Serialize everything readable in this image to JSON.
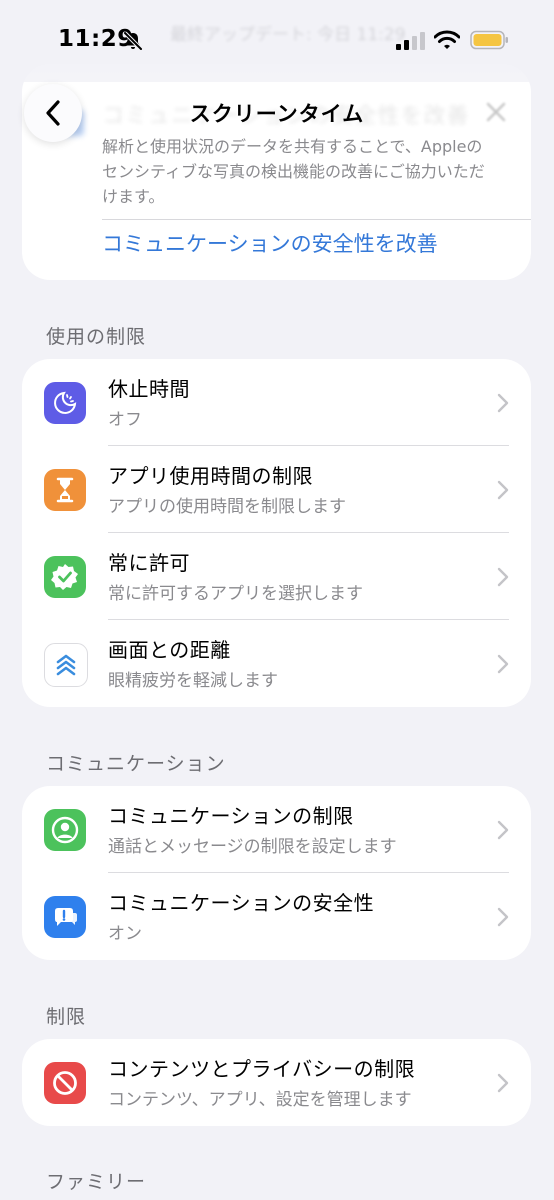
{
  "status_bar": {
    "time": "11:29",
    "ghost_text": "最終アップデート: 今日 11:29"
  },
  "nav": {
    "title": "スクリーンタイム"
  },
  "banner": {
    "heading": "コミュニケーションの安全性を改善",
    "description": "解析と使用状況のデータを共有することで、Appleのセンシティブな写真の検出機能の改善にご協力いただけます。",
    "link": "コミュニケーションの安全性を改善"
  },
  "sections": {
    "usage": {
      "header": "使用の制限",
      "rows": [
        {
          "title": "休止時間",
          "subtitle": "オフ",
          "icon": "downtime-icon",
          "color": "#5e5ce6"
        },
        {
          "title": "アプリ使用時間の制限",
          "subtitle": "アプリの使用時間を制限します",
          "icon": "hourglass-icon",
          "color": "#f0913a"
        },
        {
          "title": "常に許可",
          "subtitle": "常に許可するアプリを選択します",
          "icon": "checkmark-badge-icon",
          "color": "#4cc25c"
        },
        {
          "title": "画面との距離",
          "subtitle": "眼精疲労を軽減します",
          "icon": "screen-distance-icon",
          "color": "#ffffff"
        }
      ]
    },
    "communication": {
      "header": "コミュニケーション",
      "rows": [
        {
          "title": "コミュニケーションの制限",
          "subtitle": "通話とメッセージの制限を設定します",
          "icon": "person-circle-icon",
          "color": "#4cc25c"
        },
        {
          "title": "コミュニケーションの安全性",
          "subtitle": "オン",
          "icon": "chat-warning-icon",
          "color": "#2f80ed"
        }
      ]
    },
    "restrictions": {
      "header": "制限",
      "rows": [
        {
          "title": "コンテンツとプライバシーの制限",
          "subtitle": "コンテンツ、アプリ、設定を管理します",
          "icon": "no-entry-icon",
          "color": "#e84a4a"
        }
      ]
    },
    "family": {
      "header": "ファミリー"
    }
  }
}
